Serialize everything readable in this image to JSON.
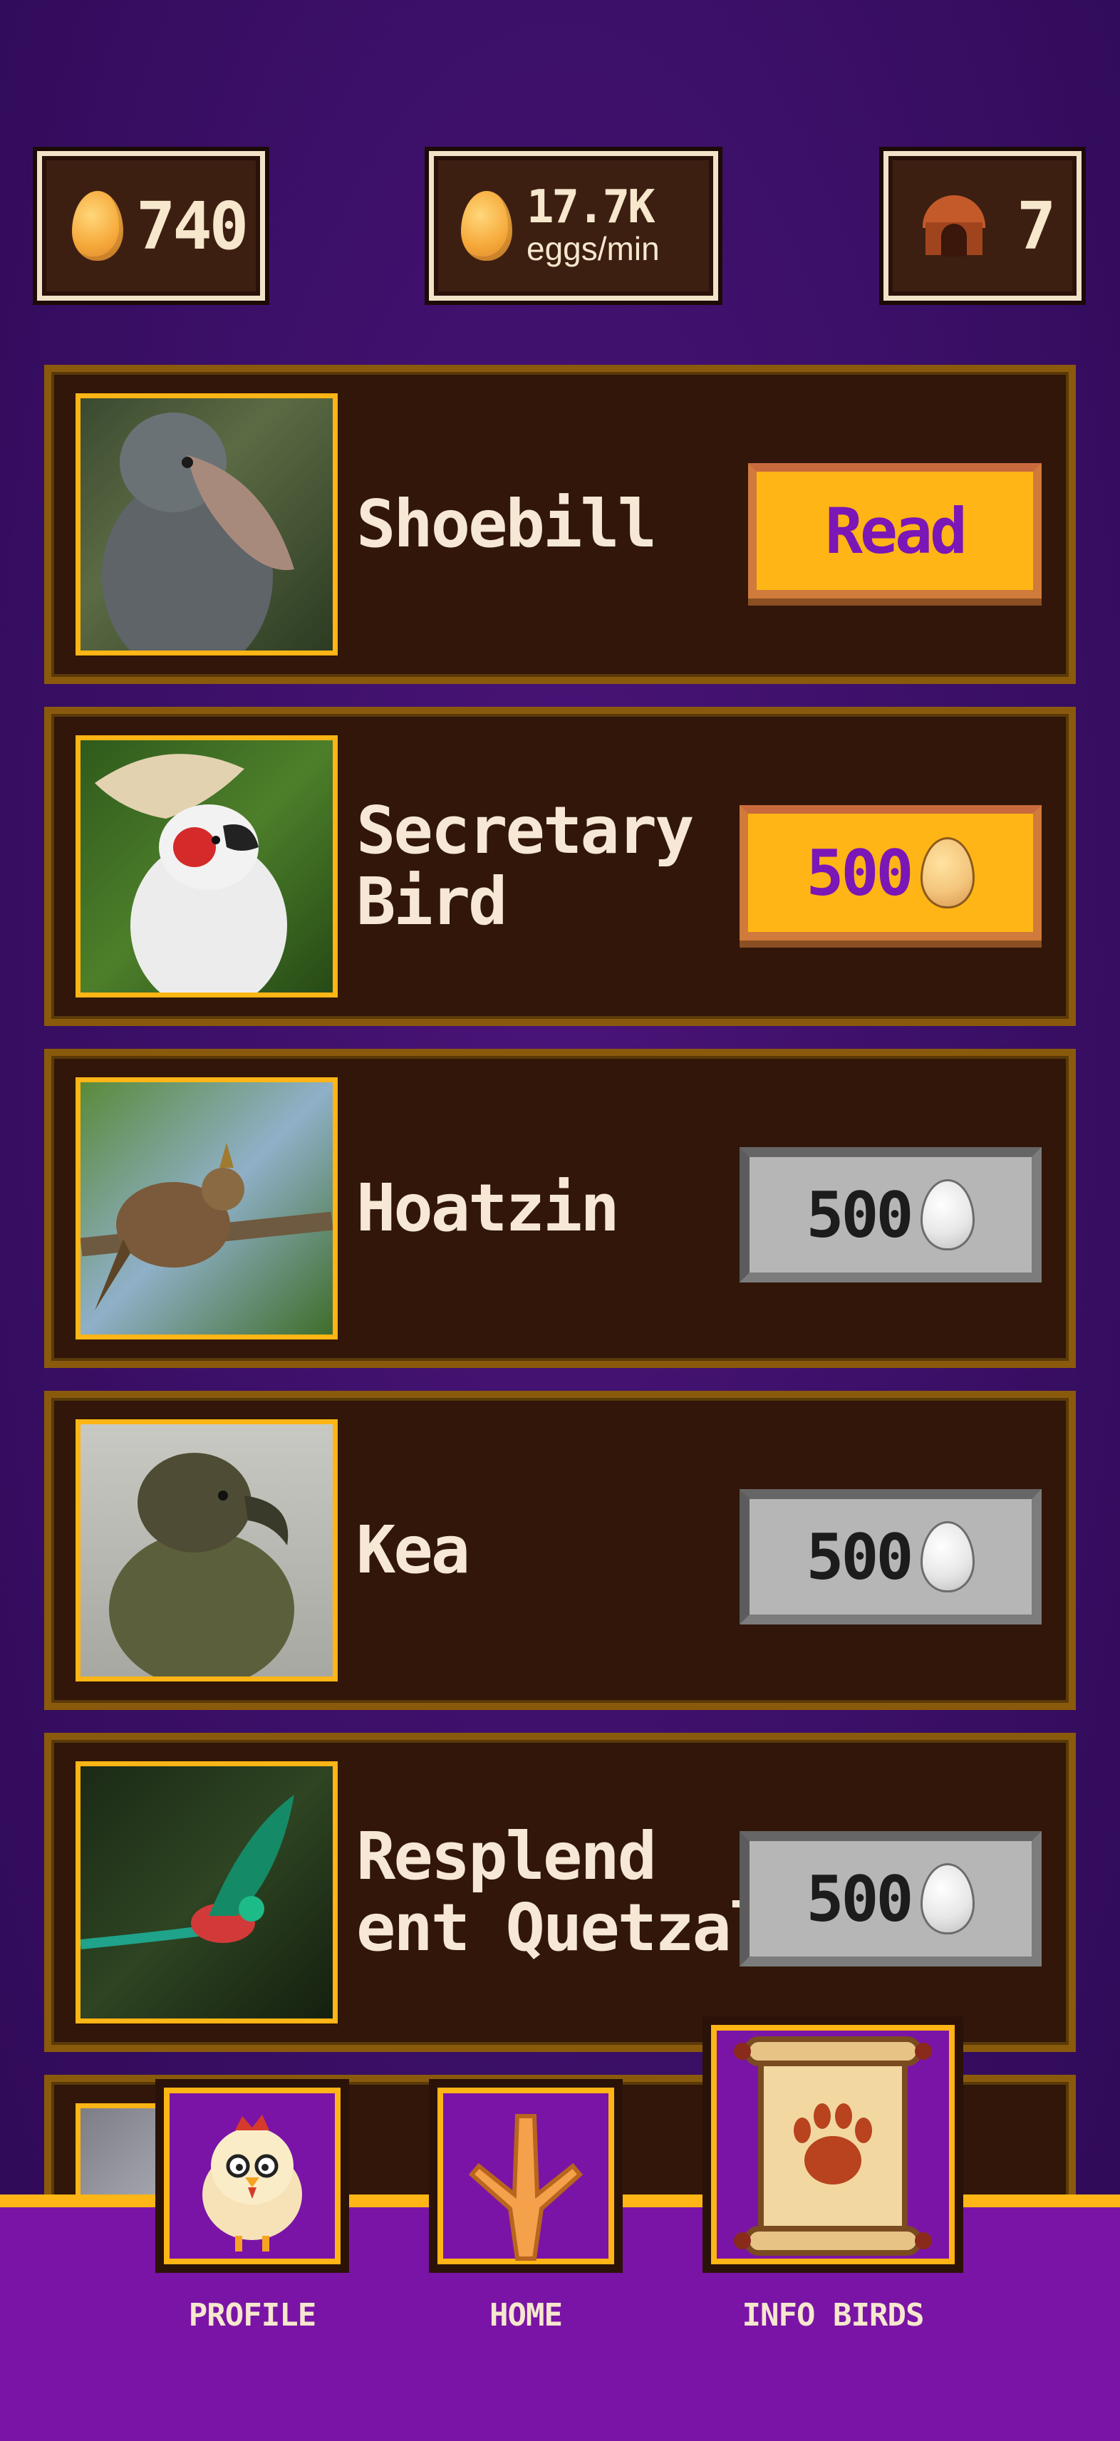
{
  "stats": {
    "eggs_count": "740",
    "rate_value": "17.7K",
    "rate_unit": "eggs/min",
    "coop_count": "7",
    "egg_icon": "egg-icon",
    "coop_icon": "coop-icon"
  },
  "birds": [
    {
      "name": "Shoebill",
      "button_type": "read",
      "button_label": "Read"
    },
    {
      "name": "Secretary Bird",
      "button_type": "buy",
      "price": "500"
    },
    {
      "name": "Hoatzin",
      "button_type": "locked",
      "price": "500"
    },
    {
      "name": "Kea",
      "button_type": "locked",
      "price": "500"
    },
    {
      "name": "Resplend ent Quetzal",
      "button_type": "locked",
      "price": "500"
    }
  ],
  "nav": {
    "profile": "PROFILE",
    "home": "HOME",
    "info_birds": "INFO BIRDS"
  },
  "colors": {
    "background": "#3a0f66",
    "card": "#311609",
    "card_border": "#8a5a0c",
    "accent_gold": "#ffb515",
    "accent_purple": "#7b16b7",
    "nav_bar": "#7a14a6"
  }
}
